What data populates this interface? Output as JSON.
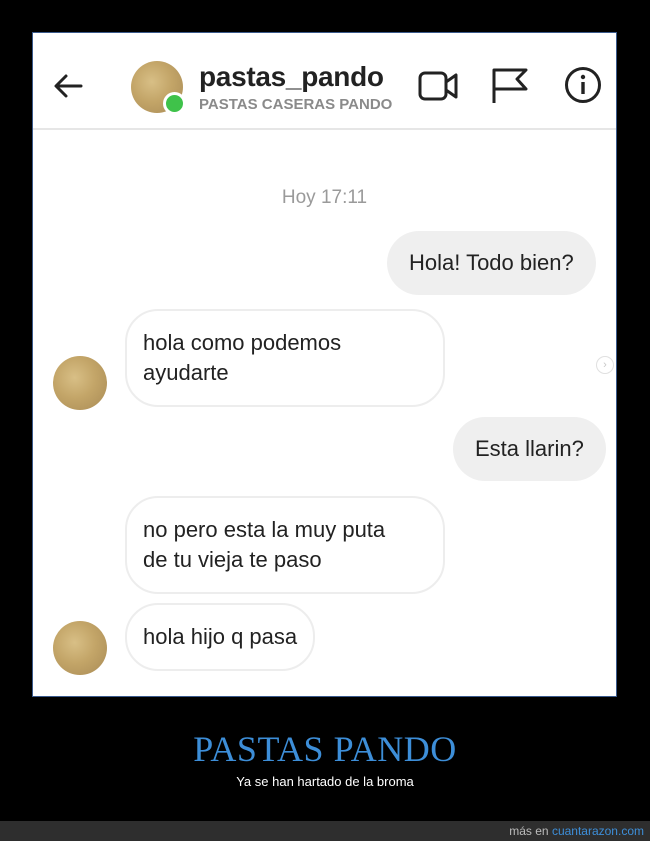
{
  "header": {
    "username": "pastas_pando",
    "subtitle": "PASTAS CASERAS PANDO",
    "icons": [
      "back-arrow-icon",
      "video-call-icon",
      "flag-icon",
      "info-icon"
    ],
    "online_color": "#3fc24a"
  },
  "chat": {
    "timestamp": "Hoy 17:11",
    "messages": [
      {
        "from": "me",
        "text": "Hola! Todo bien?"
      },
      {
        "from": "them",
        "line1": "hola como podemos",
        "line2": "ayudarte"
      },
      {
        "from": "me",
        "text": "Esta llarin?"
      },
      {
        "from": "them",
        "line1": "no pero esta la muy puta",
        "line2": "de tu vieja te paso"
      },
      {
        "from": "them",
        "text": "hola hijo q pasa"
      }
    ]
  },
  "caption": {
    "title": "PASTAS PANDO",
    "subtitle": "Ya se han hartado de la broma",
    "accent_color": "#3d8ed8"
  },
  "footer": {
    "prefix": "más en",
    "link": "cuantarazon.com"
  }
}
